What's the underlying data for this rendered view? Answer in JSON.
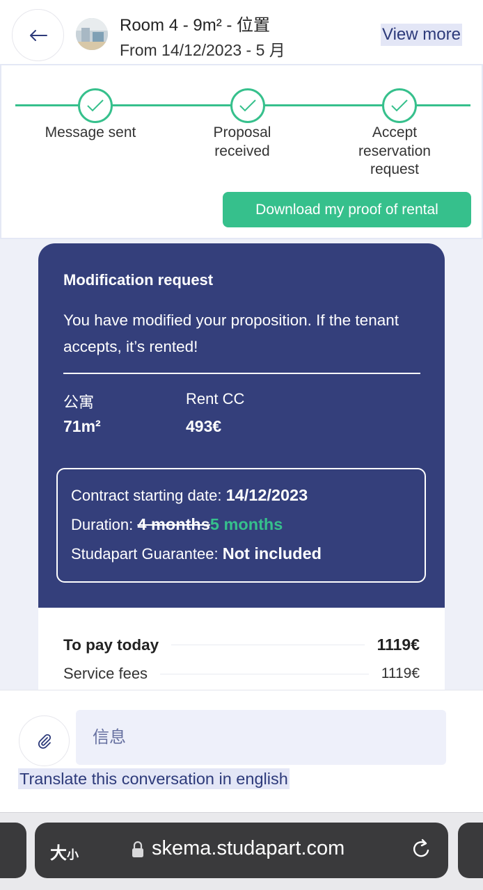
{
  "header": {
    "title": "Room 4 - 9m² - 位置",
    "subtitle": "From 14/12/2023 - 5 月",
    "view_more": "View more"
  },
  "progress": {
    "steps": [
      {
        "label": "Message sent",
        "done": true
      },
      {
        "label": "Proposal received",
        "done": true
      },
      {
        "label": "Accept reservation request",
        "done": true
      }
    ],
    "download_label": "Download my proof of rental"
  },
  "modification": {
    "title": "Modification request",
    "text": "You have modified your proposition. If the tenant accepts, it’s rented!",
    "apartment_label": "公寓",
    "apartment_value": "71m²",
    "rent_label": "Rent CC",
    "rent_value": "493€",
    "contract": {
      "start_label": "Contract starting date:",
      "start_value": "14/12/2023",
      "duration_label": "Duration:",
      "duration_old": "4 months",
      "duration_new": "5 months",
      "guarantee_label": "Studapart Guarantee:",
      "guarantee_value": "Not included"
    }
  },
  "payment": {
    "today_label": "To pay today",
    "today_value": "1119€",
    "fees_label": "Service fees",
    "fees_value": "1119€"
  },
  "composer": {
    "placeholder": "信息",
    "translate_label": "Translate this conversation in english"
  },
  "browser": {
    "text_size_label": "大",
    "text_size_small": "小",
    "url": "skema.studapart.com"
  },
  "colors": {
    "accent_green": "#36c08c",
    "navy": "#343f7b",
    "link": "#2d3a7a"
  }
}
